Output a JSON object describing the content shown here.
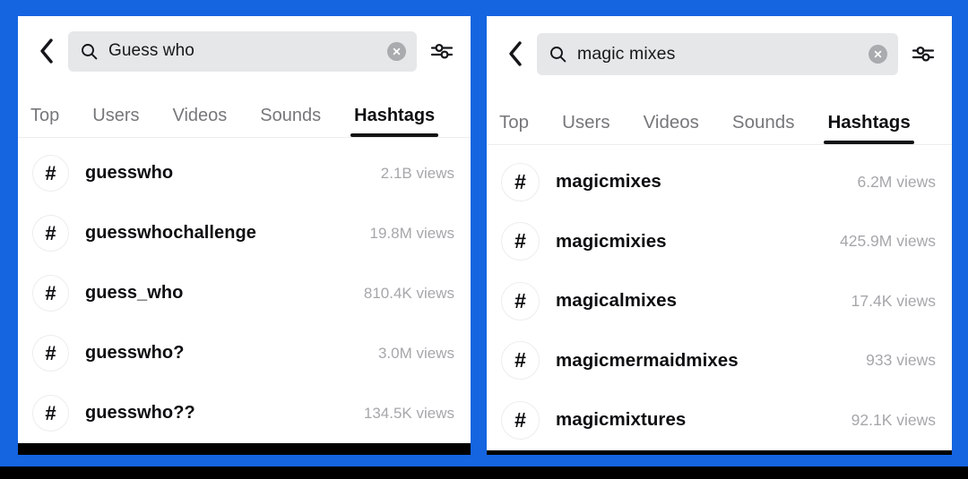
{
  "theme": {
    "background_blue": "#1565e0",
    "panel_background": "#ffffff",
    "search_pill_background": "#e6e7e9",
    "active_tab_color": "#0f1012",
    "inactive_tab_color": "#75777a",
    "views_text_color": "#a5a7aa",
    "footer_black": "#000000"
  },
  "panels": [
    {
      "id": "left",
      "search": {
        "value": "Guess who",
        "placeholder": "Search",
        "search_icon": "search-icon",
        "clear_icon": "clear-icon",
        "back_icon": "back-chevron-icon",
        "filter_icon": "filter-sliders-icon"
      },
      "tabs": [
        {
          "label": "Top",
          "active": false
        },
        {
          "label": "Users",
          "active": false
        },
        {
          "label": "Videos",
          "active": false
        },
        {
          "label": "Sounds",
          "active": false
        },
        {
          "label": "Hashtags",
          "active": true
        }
      ],
      "hashtags": [
        {
          "hash": "#",
          "name": "guesswho",
          "views": "2.1B views"
        },
        {
          "hash": "#",
          "name": "guesswhochallenge",
          "views": "19.8M views"
        },
        {
          "hash": "#",
          "name": "guess_who",
          "views": "810.4K views"
        },
        {
          "hash": "#",
          "name": "guesswho?",
          "views": "3.0M views"
        },
        {
          "hash": "#",
          "name": "guesswho??",
          "views": "134.5K views"
        }
      ]
    },
    {
      "id": "right",
      "search": {
        "value": "magic mixes",
        "placeholder": "Search",
        "search_icon": "search-icon",
        "clear_icon": "clear-icon",
        "back_icon": "back-chevron-icon",
        "filter_icon": "filter-sliders-icon"
      },
      "tabs": [
        {
          "label": "Top",
          "active": false
        },
        {
          "label": "Users",
          "active": false
        },
        {
          "label": "Videos",
          "active": false
        },
        {
          "label": "Sounds",
          "active": false
        },
        {
          "label": "Hashtags",
          "active": true
        }
      ],
      "hashtags": [
        {
          "hash": "#",
          "name": "magicmixes",
          "views": "6.2M views"
        },
        {
          "hash": "#",
          "name": "magicmixies",
          "views": "425.9M views"
        },
        {
          "hash": "#",
          "name": "magicalmixes",
          "views": "17.4K views"
        },
        {
          "hash": "#",
          "name": "magicmermaidmixes",
          "views": "933 views"
        },
        {
          "hash": "#",
          "name": "magicmixtures",
          "views": "92.1K views"
        }
      ]
    }
  ]
}
